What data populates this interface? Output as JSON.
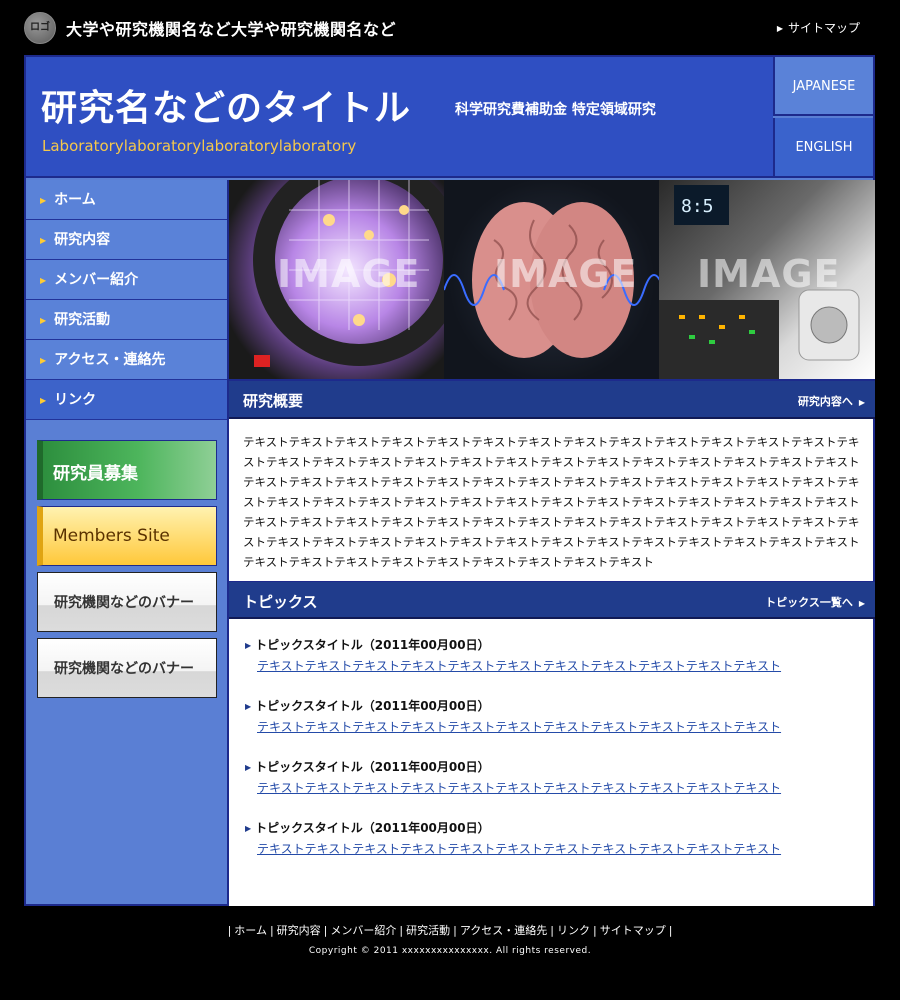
{
  "topbar": {
    "logo_text": "ロゴ",
    "org_name": "大学や研究機関名など大学や研究機関名など",
    "sitemap_label": "サイトマップ"
  },
  "header": {
    "title": "研究名などのタイトル",
    "subtitle": "科学研究費補助金 特定領域研究",
    "lab_name": "Laboratorylaboratorylaboratorylaboratory",
    "lang_japanese": "JAPANESE",
    "lang_english": "ENGLISH"
  },
  "nav": {
    "items": [
      {
        "label": "ホーム"
      },
      {
        "label": "研究内容"
      },
      {
        "label": "メンバー紹介"
      },
      {
        "label": "研究活動"
      },
      {
        "label": "アクセス・連絡先"
      },
      {
        "label": "リンク"
      }
    ]
  },
  "banners": {
    "recruit": "研究員募集",
    "members": "Members Site",
    "institution_1": "研究機関などのバナー",
    "institution_2": "研究機関などのバナー"
  },
  "hero": {
    "captions": [
      "IMAGE",
      "IMAGE",
      "IMAGE"
    ]
  },
  "about": {
    "title": "研究概要",
    "link_label": "研究内容へ",
    "text": "テキストテキストテキストテキストテキストテキストテキストテキストテキストテキストテキストテキストテキストテキストテキストテキストテキストテキストテキストテキストテキストテキストテキストテキストテキストテキストテキストテキストテキストテキストテキストテキストテキストテキストテキストテキストテキストテキストテキストテキストテキストテキストテキストテキストテキストテキストテキストテキストテキストテキストテキストテキストテキストテキストテキストテキストテキストテキストテキストテキストテキストテキストテキストテキストテキストテキストテキストテキストテキストテキストテキストテキストテキストテキストテキストテキストテキストテキストテキストテキストテキストテキストテキストテキストテキストテキストテキストテキストテキストテキスト"
  },
  "topics": {
    "title": "トピックス",
    "link_label": "トピックス一覧へ",
    "items": [
      {
        "title": "トピックスタイトル（2011年00月00日）",
        "text": "テキストテキストテキストテキストテキストテキストテキストテキストテキストテキストテキスト"
      },
      {
        "title": "トピックスタイトル（2011年00月00日）",
        "text": "テキストテキストテキストテキストテキストテキストテキストテキストテキストテキストテキスト"
      },
      {
        "title": "トピックスタイトル（2011年00月00日）",
        "text": "テキストテキストテキストテキストテキストテキストテキストテキストテキストテキストテキスト"
      },
      {
        "title": "トピックスタイトル（2011年00月00日）",
        "text": "テキストテキストテキストテキストテキストテキストテキストテキストテキストテキストテキスト"
      }
    ]
  },
  "footer": {
    "links": [
      "ホーム",
      "研究内容",
      "メンバー紹介",
      "研究活動",
      "アクセス・連絡先",
      "リンク",
      "サイトマップ"
    ],
    "copyright": "Copyright © 2011 xxxxxxxxxxxxxxx. All rights reserved."
  },
  "colors": {
    "header_blue": "#2f4fc2",
    "nav_blue": "#5a82d8",
    "section_head": "#203c8c",
    "lab_name": "#f5c84b",
    "link_text": "#244ba8"
  }
}
